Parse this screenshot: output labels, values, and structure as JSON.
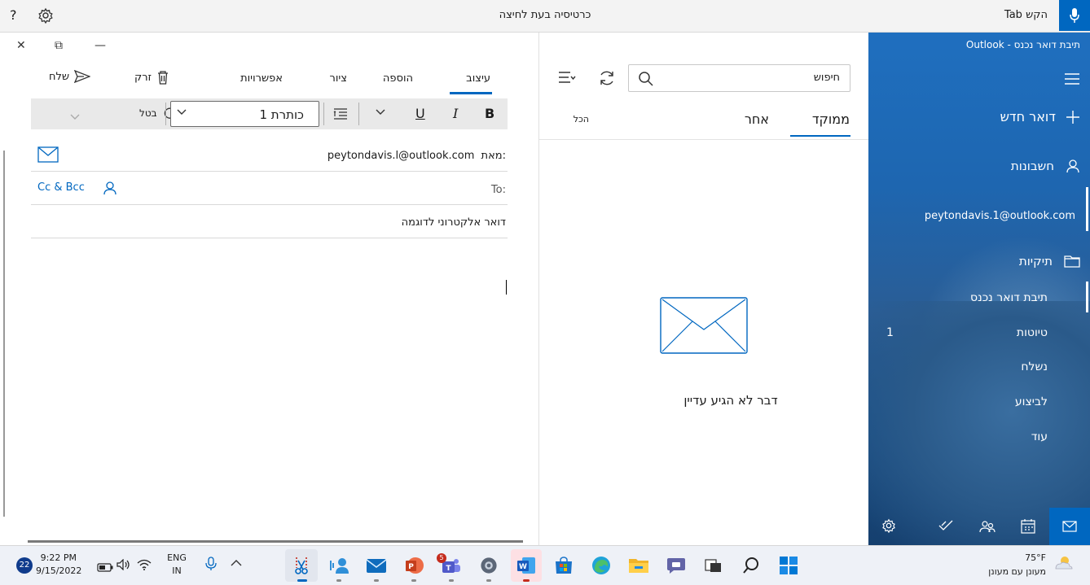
{
  "keyboard_bar": {
    "tab_hint": "הקש Tab",
    "title": "כרטיסיה בעת לחיצה"
  },
  "compose": {
    "menu": {
      "format": "עיצוב",
      "insert": "הוספה",
      "draw": "ציור",
      "options": "אפשרויות",
      "discard": "זרק",
      "send": "שלח"
    },
    "format_bar": {
      "bold": "B",
      "italic": "I",
      "underline": "U",
      "heading_value": "כותרת 1",
      "undo_label": "בטל"
    },
    "from_label": "מאת:",
    "from_value": "peytondavis.l@outlook.com",
    "to_label": "To:",
    "cc_bcc": "Cc & Bcc",
    "subject_value": "דואר אלקטרוני לדוגמה"
  },
  "message_list": {
    "search_placeholder": "חיפוש",
    "tabs": {
      "focused": "ממוקד",
      "other": "אחר",
      "all": "הכל"
    },
    "empty_message": "דבר לא הגיע עדיין"
  },
  "nav": {
    "title": "תיבת דואר נכנס - Outlook",
    "new_mail": "דואר חדש",
    "accounts": "חשבונות",
    "account_email": "peytondavis.1@outlook.com",
    "folders": "תיקיות",
    "folder_items": [
      {
        "label": "תיבת דואר נכנס",
        "count": ""
      },
      {
        "label": "טיוטות",
        "count": "1"
      },
      {
        "label": "נשלח",
        "count": ""
      },
      {
        "label": "לביצוע",
        "count": ""
      },
      {
        "label": "עוד",
        "count": ""
      }
    ]
  },
  "taskbar": {
    "weather_temp": "75°F",
    "weather_desc": "מעונן עם מעונן",
    "lang_top": "ENG",
    "lang_bottom": "IN",
    "time": "9:22 PM",
    "date": "9/15/2022",
    "notification_count": "22",
    "teams_badge": "5"
  },
  "colors": {
    "accent": "#0067c0",
    "nav_bg": "#1f6fbf"
  }
}
